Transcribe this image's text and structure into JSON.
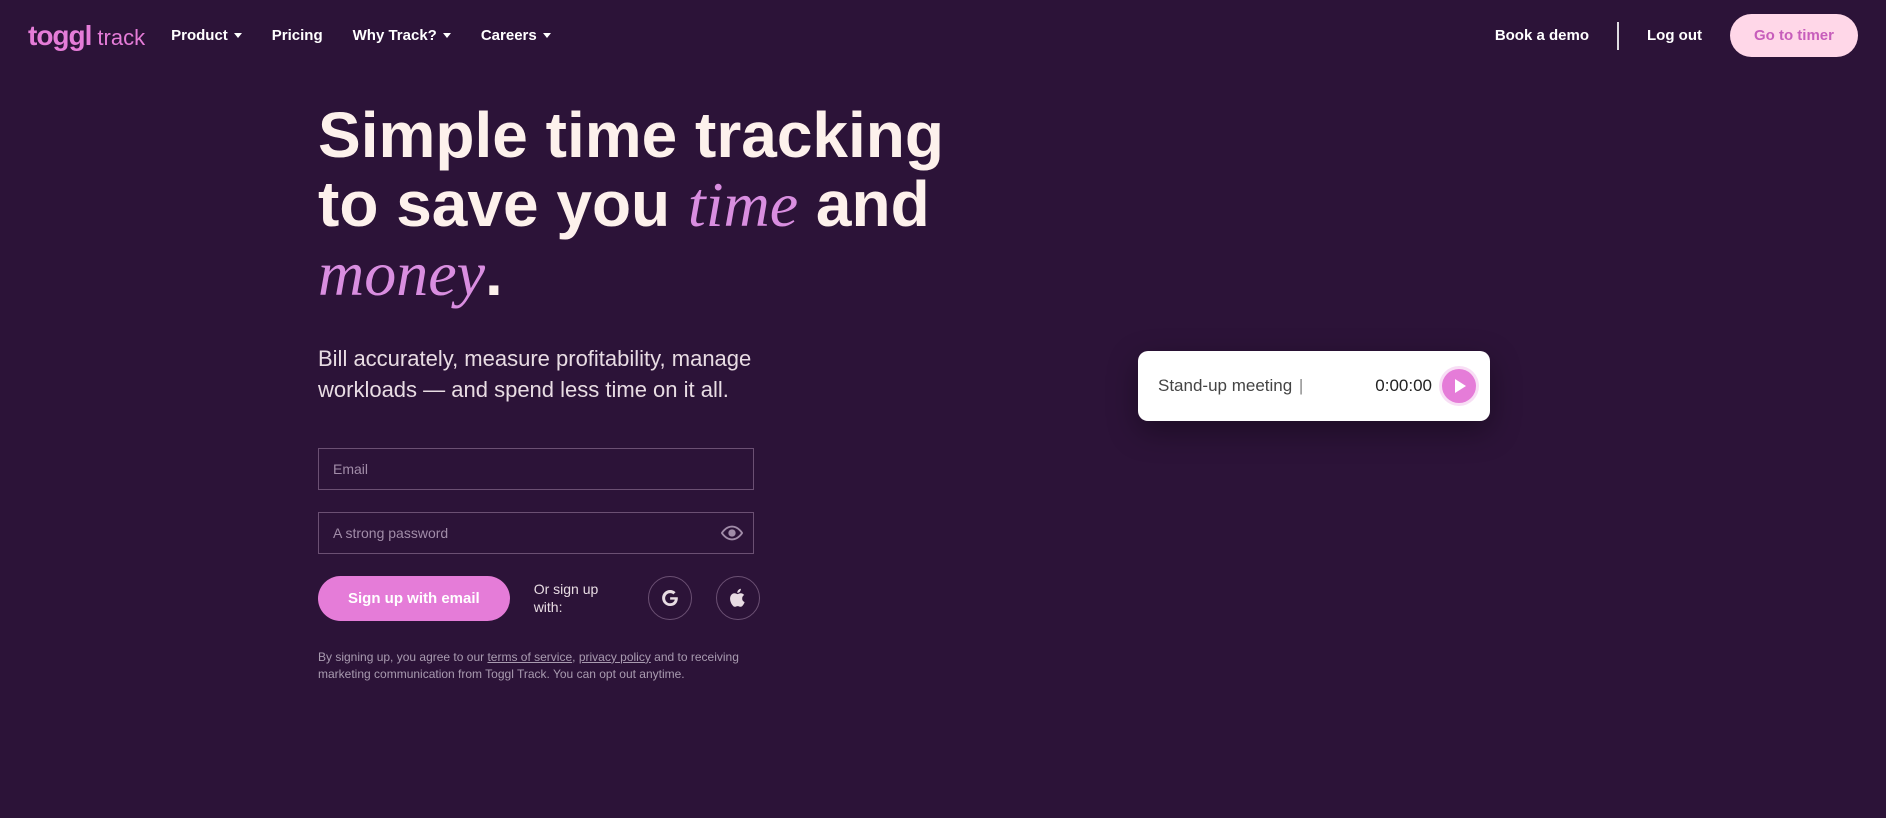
{
  "brand": {
    "name": "toggl",
    "suffix": "track"
  },
  "nav": {
    "items": [
      {
        "label": "Product",
        "hasDropdown": true
      },
      {
        "label": "Pricing",
        "hasDropdown": false
      },
      {
        "label": "Why Track?",
        "hasDropdown": true
      },
      {
        "label": "Careers",
        "hasDropdown": true
      }
    ]
  },
  "header": {
    "demo": "Book a demo",
    "logout": "Log out",
    "timer_btn": "Go to timer"
  },
  "hero": {
    "title_1": "Simple time tracking to save you ",
    "accent_1": "time",
    "title_2": " and ",
    "accent_2": "money",
    "title_3": ".",
    "subhead": "Bill accurately, measure profitability, manage workloads — and spend less time on it all."
  },
  "form": {
    "email_placeholder": "Email",
    "password_placeholder": "A strong password",
    "signup_btn": "Sign up with email",
    "or_sign": "Or sign up with:"
  },
  "legal": {
    "prefix": "By signing up, you agree to our ",
    "terms": "terms of service",
    "sep": ", ",
    "privacy": "privacy policy",
    "suffix": " and to receiving marketing communication from Toggl Track. You can opt out anytime."
  },
  "timer": {
    "label": "Stand-up meeting",
    "time": "0:00:00"
  }
}
